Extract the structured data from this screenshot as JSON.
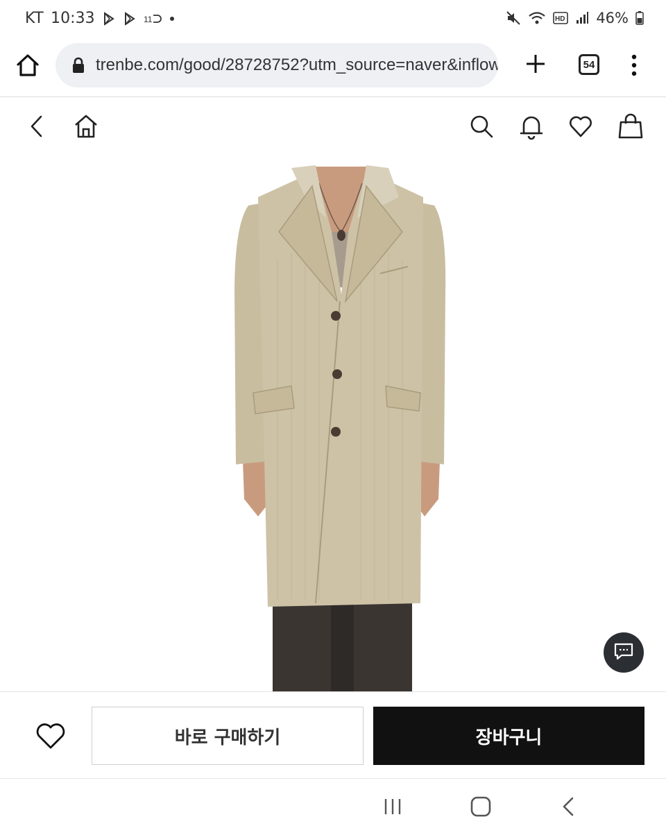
{
  "status_bar": {
    "carrier": "KT",
    "time": "10:33",
    "notification_icons": [
      "play-store-icon",
      "play-store-icon",
      "11st-icon"
    ],
    "battery": "46%"
  },
  "browser": {
    "url": "trenbe.com/good/28728752?utm_source=naver&inflow",
    "tab_count": "54"
  },
  "site_header": {
    "icons": [
      "back-arrow-icon",
      "home-icon",
      "search-icon",
      "bell-icon",
      "heart-icon",
      "shopping-bag-icon"
    ]
  },
  "product": {
    "coat_color": "#cdc2a6",
    "trousers_color": "#3a3531"
  },
  "actions": {
    "buy_now_label": "바로 구매하기",
    "cart_label": "장바구니"
  },
  "colors": {
    "cart_button_bg": "#111111",
    "chat_button_bg": "#2b2e33"
  }
}
